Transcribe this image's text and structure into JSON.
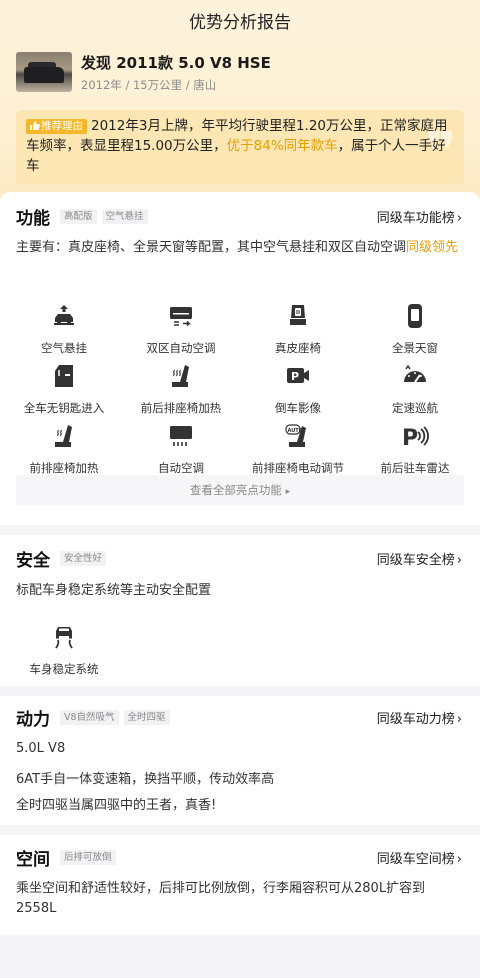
{
  "header": {
    "title": "优势分析报告"
  },
  "car": {
    "name": "发现 2011款 5.0 V8 HSE",
    "year": "2012年",
    "mileage": "15万公里",
    "city": "唐山",
    "separator": "/"
  },
  "recommend": {
    "tag": "推荐理由",
    "text_before": "2012年3月上牌，年平均行驶里程1.20万公里，正常家庭用车频率，表显里程15.00万公里，",
    "highlight": "优于84%同年款车",
    "text_after": "，属于个人一手好车"
  },
  "function": {
    "title": "功能",
    "tags": [
      "高配版",
      "空气悬挂"
    ],
    "rank_label": "同级车功能榜",
    "desc_before": "主要有：真皮座椅、全景天窗等配置，其中空气悬挂和双区自动空调",
    "desc_highlight": "同级领先",
    "features": [
      {
        "label": "空气悬挂",
        "icon": "air-suspension-icon"
      },
      {
        "label": "双区自动空调",
        "icon": "dual-zone-ac-icon"
      },
      {
        "label": "真皮座椅",
        "icon": "leather-seat-icon"
      },
      {
        "label": "全景天窗",
        "icon": "panoramic-sunroof-icon"
      },
      {
        "label": "全车无钥匙进入",
        "icon": "keyless-entry-icon"
      },
      {
        "label": "前后排座椅加热",
        "icon": "seat-heating-icon"
      },
      {
        "label": "倒车影像",
        "icon": "reverse-camera-icon"
      },
      {
        "label": "定速巡航",
        "icon": "cruise-control-icon"
      },
      {
        "label": "前排座椅加热",
        "icon": "front-seat-heating-icon"
      },
      {
        "label": "自动空调",
        "icon": "auto-ac-icon"
      },
      {
        "label": "前排座椅电动调节",
        "icon": "power-seat-icon"
      },
      {
        "label": "前后驻车雷达",
        "icon": "parking-radar-icon"
      }
    ],
    "view_all": "查看全部亮点功能",
    "view_all_arrow": "▸"
  },
  "safety": {
    "title": "安全",
    "tags": [
      "安全性好"
    ],
    "rank_label": "同级车安全榜",
    "desc": "标配车身稳定系统等主动安全配置",
    "features": [
      {
        "label": "车身稳定系统",
        "icon": "stability-control-icon"
      }
    ]
  },
  "power": {
    "title": "动力",
    "tags": [
      "V8自然吸气",
      "全时四驱"
    ],
    "rank_label": "同级车动力榜",
    "lines": [
      "5.0L V8",
      "6AT手自一体变速箱，换挡平顺，传动效率高",
      "全时四驱当属四驱中的王者，真香!"
    ]
  },
  "space": {
    "title": "空间",
    "tags": [
      "后排可放倒"
    ],
    "rank_label": "同级车空间榜",
    "desc": "乘坐空间和舒适性较好，后排可比例放倒，行李厢容积可从280L扩容到2558L"
  },
  "ui": {
    "chevron": "›"
  },
  "colors": {
    "accent": "#e8a000",
    "tag_bg": "#f5b82a",
    "page_bg": "#f4f4f6"
  }
}
